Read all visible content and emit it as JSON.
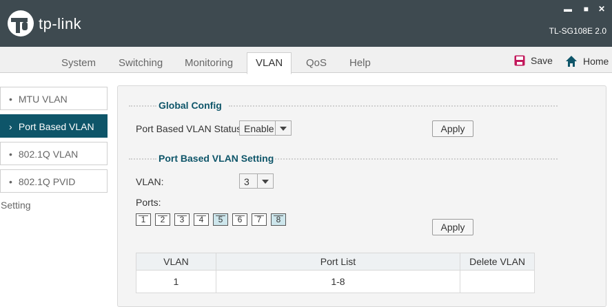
{
  "header": {
    "brand": "tp-link",
    "model": "TL-SG108E 2.0",
    "window_controls": {
      "minimize": "▬",
      "maximize": "■",
      "close": "✕"
    }
  },
  "nav": {
    "tabs": [
      {
        "label": "System"
      },
      {
        "label": "Switching"
      },
      {
        "label": "Monitoring"
      },
      {
        "label": "VLAN",
        "active": true
      },
      {
        "label": "QoS"
      },
      {
        "label": "Help"
      }
    ],
    "save_label": "Save",
    "home_label": "Home"
  },
  "sidebar": {
    "items": [
      {
        "label": "MTU VLAN",
        "bullet": "•"
      },
      {
        "label": "Port Based VLAN",
        "bullet": "›",
        "active": true
      },
      {
        "label": "802.1Q VLAN",
        "bullet": "•"
      },
      {
        "label": "802.1Q PVID Setting",
        "bullet": "•"
      }
    ]
  },
  "global_config": {
    "title": "Global Config",
    "status_label": "Port Based VLAN Status:",
    "status_value": "Enable",
    "apply_label": "Apply"
  },
  "vlan_setting": {
    "title": "Port Based VLAN Setting",
    "vlan_label": "VLAN:",
    "vlan_value": "3",
    "ports_label": "Ports:",
    "ports": [
      {
        "num": "1",
        "selected": false
      },
      {
        "num": "2",
        "selected": false
      },
      {
        "num": "3",
        "selected": false
      },
      {
        "num": "4",
        "selected": false
      },
      {
        "num": "5",
        "selected": true
      },
      {
        "num": "6",
        "selected": false
      },
      {
        "num": "7",
        "selected": false
      },
      {
        "num": "8",
        "selected": true
      }
    ],
    "apply_label": "Apply"
  },
  "table": {
    "headers": [
      "VLAN",
      "Port List",
      "Delete VLAN"
    ],
    "rows": [
      [
        "1",
        "1-8",
        ""
      ]
    ]
  },
  "colors": {
    "header_bg": "#3e4a50",
    "accent": "#0e5569",
    "save_icon": "#c2185b",
    "home_icon": "#0e5569"
  },
  "icons": {
    "save": "floppy-disk-icon",
    "home": "home-icon"
  }
}
